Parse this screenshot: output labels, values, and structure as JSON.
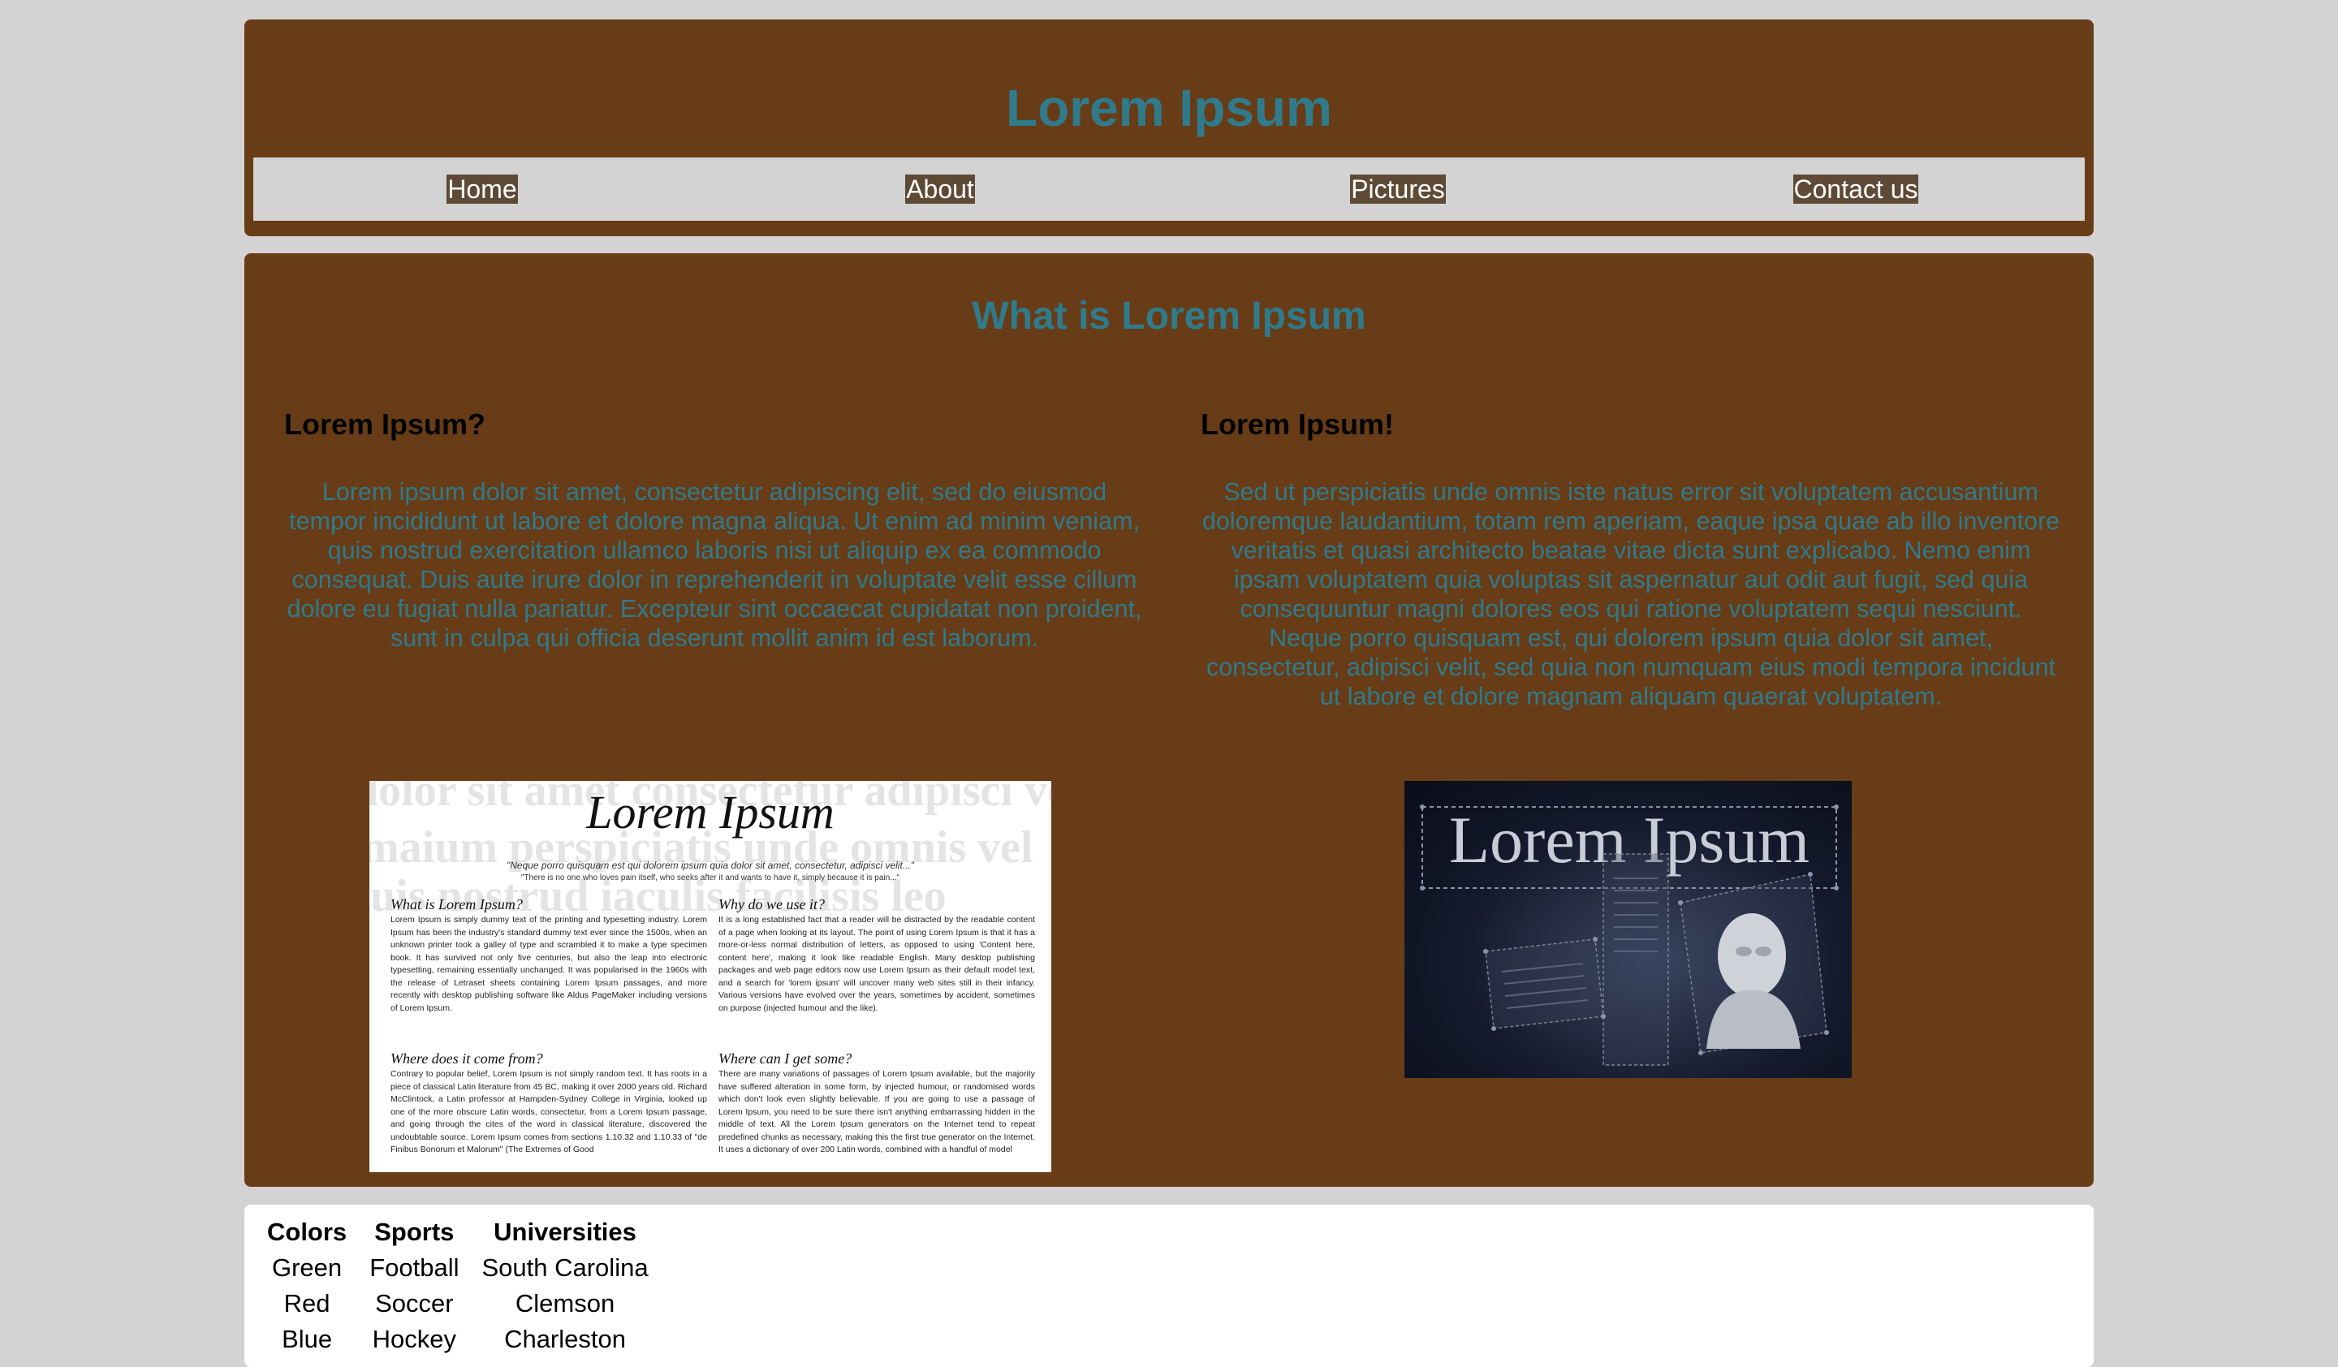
{
  "header": {
    "title": "Lorem Ipsum",
    "nav": [
      "Home",
      "About",
      "Pictures",
      "Contact us"
    ]
  },
  "main": {
    "title": "What is Lorem Ipsum",
    "left": {
      "heading": "Lorem Ipsum?",
      "text": "Lorem ipsum dolor sit amet, consectetur adipiscing elit, sed do eiusmod tempor incididunt ut labore et dolore magna aliqua. Ut enim ad minim veniam, quis nostrud exercitation ullamco laboris nisi ut aliquip ex ea commodo consequat. Duis aute irure dolor in reprehenderit in voluptate velit esse cillum dolore eu fugiat nulla pariatur. Excepteur sint occaecat cupidatat non proident, sunt in culpa qui officia deserunt mollit anim id est laborum."
    },
    "right": {
      "heading": "Lorem Ipsum!",
      "text": "Sed ut perspiciatis unde omnis iste natus error sit voluptatem accusantium doloremque laudantium, totam rem aperiam, eaque ipsa quae ab illo inventore veritatis et quasi architecto beatae vitae dicta sunt explicabo. Nemo enim ipsam voluptatem quia voluptas sit aspernatur aut odit aut fugit, sed quia consequuntur magni dolores eos qui ratione voluptatem sequi nesciunt. Neque porro quisquam est, qui dolorem ipsum quia dolor sit amet, consectetur, adipisci velit, sed quia non numquam eius modi tempora incidunt ut labore et dolore magnam aliquam quaerat voluptatem."
    },
    "image_left": {
      "title": "Lorem Ipsum",
      "quote": "\"Neque porro quisquam est qui dolorem ipsum quia dolor sit amet, consectetur, adipisci velit...\"",
      "subquote": "\"There is no one who loves pain itself, who seeks after it and wants to have it, simply because it is pain...\"",
      "sections": [
        {
          "heading": "What is Lorem Ipsum?",
          "body": "Lorem Ipsum is simply dummy text of the printing and typesetting industry. Lorem Ipsum has been the industry's standard dummy text ever since the 1500s, when an unknown printer took a galley of type and scrambled it to make a type specimen book. It has survived not only five centuries, but also the leap into electronic typesetting, remaining essentially unchanged. It was popularised in the 1960s with the release of Letraset sheets containing Lorem Ipsum passages, and more recently with desktop publishing software like Aldus PageMaker including versions of Lorem Ipsum."
        },
        {
          "heading": "Why do we use it?",
          "body": "It is a long established fact that a reader will be distracted by the readable content of a page when looking at its layout. The point of using Lorem Ipsum is that it has a more-or-less normal distribution of letters, as opposed to using 'Content here, content here', making it look like readable English. Many desktop publishing packages and web page editors now use Lorem Ipsum as their default model text, and a search for 'lorem ipsum' will uncover many web sites still in their infancy. Various versions have evolved over the years, sometimes by accident, sometimes on purpose (injected humour and the like)."
        },
        {
          "heading": "Where does it come from?",
          "body": "Contrary to popular belief, Lorem Ipsum is not simply random text. It has roots in a piece of classical Latin literature from 45 BC, making it over 2000 years old. Richard McClintock, a Latin professor at Hampden-Sydney College in Virginia, looked up one of the more obscure Latin words, consectetur, from a Lorem Ipsum passage, and going through the cites of the word in classical literature, discovered the undoubtable source. Lorem Ipsum comes from sections 1.10.32 and 1.10.33 of \"de Finibus Bonorum et Malorum\" (The Extremes of Good"
        },
        {
          "heading": "Where can I get some?",
          "body": "There are many variations of passages of Lorem Ipsum available, but the majority have suffered alteration in some form, by injected humour, or randomised words which don't look even slightly believable. If you are going to use a passage of Lorem Ipsum, you need to be sure there isn't anything embarrassing hidden in the middle of text. All the Lorem Ipsum generators on the Internet tend to repeat predefined chunks as necessary, making this the first true generator on the Internet. It uses a dictionary of over 200 Latin words, combined with a handful of model"
        }
      ]
    },
    "image_right": {
      "title": "Lorem Ipsum"
    }
  },
  "footer": {
    "headers": [
      "Colors",
      "Sports",
      "Universities"
    ],
    "rows": [
      [
        "Green",
        "Football",
        "South Carolina"
      ],
      [
        "Red",
        "Soccer",
        "Clemson"
      ],
      [
        "Blue",
        "Hockey",
        "Charleston"
      ]
    ]
  }
}
